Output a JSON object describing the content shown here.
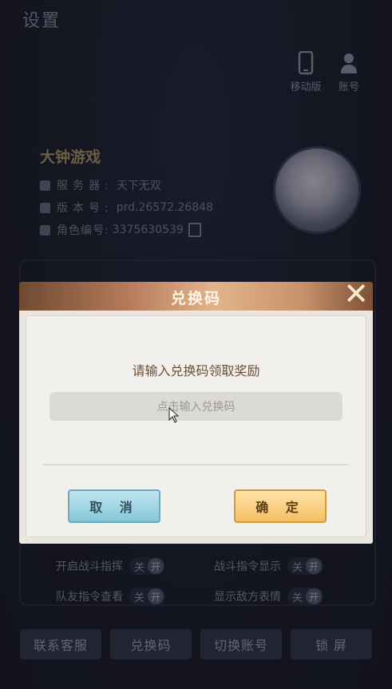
{
  "page": {
    "title": "设置"
  },
  "top_buttons": [
    {
      "label": "移动版",
      "icon": "phone-icon"
    },
    {
      "label": "账号",
      "icon": "user-icon"
    }
  ],
  "profile": {
    "game_name": "大钟游戏",
    "server_label": "服务器:",
    "server_value": "天下无双",
    "version_label": "版本号:",
    "version_value": "prd.26572.26848",
    "role_label": "角色编号:",
    "role_value": "3375630539"
  },
  "toggles": [
    {
      "label": "开启战斗指挥",
      "off": "关",
      "on": "开"
    },
    {
      "label": "战斗指令显示",
      "off": "关",
      "on": "开"
    },
    {
      "label": "队友指令查看",
      "off": "关",
      "on": "开"
    },
    {
      "label": "显示敌方表情",
      "off": "关",
      "on": "开"
    }
  ],
  "bottom_buttons": [
    "联系客服",
    "兑换码",
    "切换账号",
    "锁 屏"
  ],
  "dialog": {
    "title": "兑换码",
    "prompt": "请输入兑换码领取奖励",
    "input_placeholder": "点击输入兑换码",
    "cancel_label": "取 消",
    "confirm_label": "确 定"
  },
  "colors": {
    "background": "#1b1e2c",
    "dialog_header": "#c8926c",
    "cancel_button": "#86c7d9",
    "confirm_button": "#f3bf63"
  }
}
